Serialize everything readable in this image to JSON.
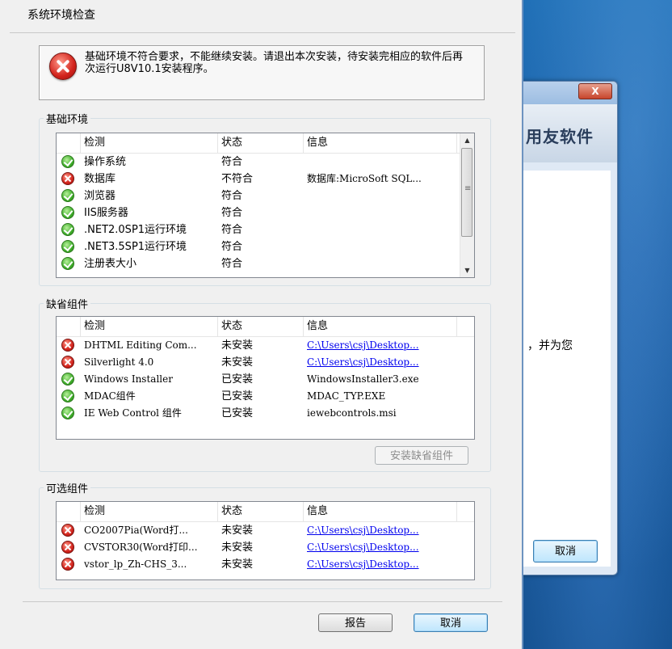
{
  "dialog": {
    "title": "系统环境检查",
    "error_message": "基础环境不符合要求，不能继续安装。请退出本次安装，待安装完相应的软件后再次运行U8V10.1安装程序。",
    "report_button": "报告",
    "cancel_button": "取消"
  },
  "columns": {
    "check": "检测",
    "status": "状态",
    "info": "信息"
  },
  "basic_env": {
    "label": "基础环境",
    "rows": [
      {
        "icon": "ok",
        "check": "操作系统",
        "status": "符合",
        "info": ""
      },
      {
        "icon": "bad",
        "check": "数据库",
        "status": "不符合",
        "info": "数据库:MicroSoft SQL..."
      },
      {
        "icon": "ok",
        "check": "浏览器",
        "status": "符合",
        "info": ""
      },
      {
        "icon": "ok",
        "check": "IIS服务器",
        "status": "符合",
        "info": ""
      },
      {
        "icon": "ok",
        "check": ".NET2.0SP1运行环境",
        "status": "符合",
        "info": ""
      },
      {
        "icon": "ok",
        "check": ".NET3.5SP1运行环境",
        "status": "符合",
        "info": ""
      },
      {
        "icon": "ok",
        "check": "注册表大小",
        "status": "符合",
        "info": ""
      }
    ]
  },
  "default_components": {
    "label": "缺省组件",
    "install_button": "安装缺省组件",
    "rows": [
      {
        "icon": "bad",
        "check": "DHTML Editing Com...",
        "status": "未安装",
        "info": "C:\\Users\\csj\\Desktop...",
        "link": true
      },
      {
        "icon": "bad",
        "check": "Silverlight 4.0",
        "status": "未安装",
        "info": "C:\\Users\\csj\\Desktop...",
        "link": true
      },
      {
        "icon": "ok",
        "check": "Windows Installer",
        "status": "已安装",
        "info": "WindowsInstaller3.exe",
        "link": false
      },
      {
        "icon": "ok",
        "check": "MDAC组件",
        "status": "已安装",
        "info": "MDAC_TYP.EXE",
        "link": false
      },
      {
        "icon": "ok",
        "check": "IE Web Control 组件",
        "status": "已安装",
        "info": "iewebcontrols.msi",
        "link": false
      }
    ]
  },
  "optional_components": {
    "label": "可选组件",
    "rows": [
      {
        "icon": "bad",
        "check": "CO2007Pia(Word打...",
        "status": "未安装",
        "info": "C:\\Users\\csj\\Desktop...",
        "link": true
      },
      {
        "icon": "bad",
        "check": "CVSTOR30(Word打印...",
        "status": "未安装",
        "info": "C:\\Users\\csj\\Desktop...",
        "link": true
      },
      {
        "icon": "bad",
        "check": "vstor_lp_Zh-CHS_3...",
        "status": "未安装",
        "info": "C:\\Users\\csj\\Desktop...",
        "link": true
      }
    ]
  },
  "back_window": {
    "close_label": "X",
    "brand": "用友软件",
    "body_text": "，并为您",
    "cancel_button": "取消"
  }
}
